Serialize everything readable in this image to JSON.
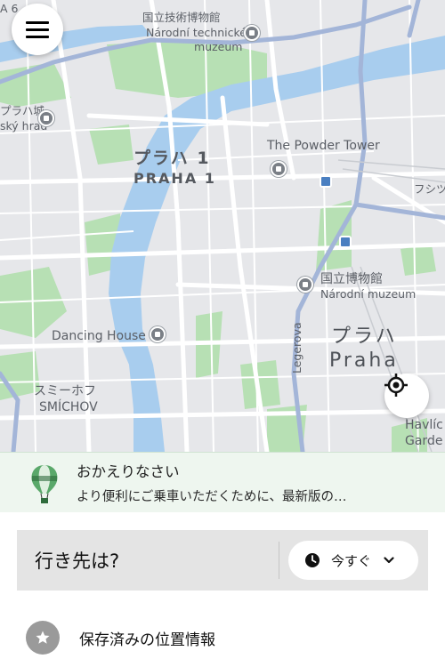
{
  "map": {
    "labels": {
      "tech_museum_jp": "国立技術博物館",
      "tech_museum_cz1": "Národní technické",
      "tech_museum_cz2": "muzeum",
      "castle_jp": "プラハ城",
      "castle_cz": "ský hrad",
      "powder_tower": "The Powder Tower",
      "praha1_jp": "プラハ 1",
      "praha1_cz": "PRAHA 1",
      "national_museum_jp": "国立博物館",
      "national_museum_cz": "Národní muzeum",
      "dancing_house": "Dancing House",
      "praha_jp": "プラハ",
      "praha_cz": "Praha",
      "smichov_jp": "スミーホフ",
      "smichov_cz": "SMÍCHOV",
      "legerova": "Legerova",
      "edge_top": "A 6",
      "edge_right": "フシツカ",
      "havlice1": "Havlíc",
      "havlice2": "Garde"
    },
    "colors": {
      "land": "#e6e7ea",
      "water": "#a8cdee",
      "park": "#b7e0b4",
      "road": "#ffffff",
      "highway": "#a3b5d8"
    }
  },
  "menu": {
    "icon": "hamburger-menu-icon"
  },
  "locate": {
    "icon": "locate-crosshair-icon"
  },
  "banner": {
    "title": "おかえりなさい",
    "subtitle": "より便利にご乗車いただくために、最新版の…",
    "icon": "hot-air-balloon-icon"
  },
  "search": {
    "placeholder": "行き先は?",
    "time_label": "今すぐ",
    "time_icon": "clock-icon",
    "chevron_icon": "chevron-down-icon"
  },
  "saved_places": {
    "label": "保存済みの位置情報",
    "icon": "star-icon"
  }
}
